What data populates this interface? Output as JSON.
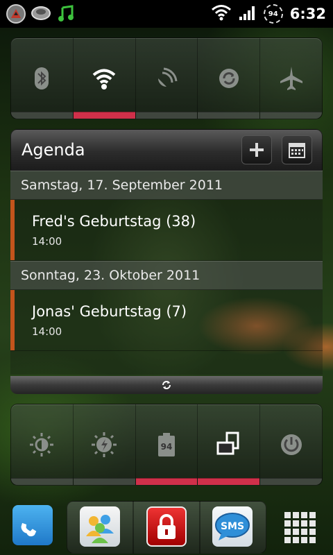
{
  "status_bar": {
    "left_icons": [
      "app-icon",
      "notification-cloud-icon",
      "music-note-icon"
    ],
    "right_icons": [
      "wifi-icon",
      "signal-icon"
    ],
    "battery_level": "94",
    "time": "6:32"
  },
  "quick_toggles_top": [
    {
      "name": "bluetooth",
      "icon": "bluetooth-icon",
      "on": false
    },
    {
      "name": "wifi",
      "icon": "wifi-icon",
      "on": true
    },
    {
      "name": "gps",
      "icon": "gps-icon",
      "on": false
    },
    {
      "name": "sync",
      "icon": "sync-icon",
      "on": false
    },
    {
      "name": "airplane",
      "icon": "airplane-icon",
      "on": false
    }
  ],
  "agenda": {
    "title": "Agenda",
    "add_icon": "plus-icon",
    "calendar_icon": "calendar-icon",
    "groups": [
      {
        "date": "Samstag, 17. September 2011",
        "events": [
          {
            "title": "Fred's Geburtstag (38)",
            "time": "14:00"
          }
        ]
      },
      {
        "date": "Sonntag, 23. Oktober 2011",
        "events": [
          {
            "title": "Jonas' Geburtstag (7)",
            "time": "14:00"
          }
        ]
      }
    ],
    "refresh_icon": "refresh-icon"
  },
  "quick_toggles_bottom": [
    {
      "name": "brightness",
      "icon": "brightness-icon",
      "on": false
    },
    {
      "name": "auto-brightness",
      "icon": "auto-brightness-icon",
      "on": false
    },
    {
      "name": "battery",
      "icon": "battery-icon",
      "label": "94",
      "on": true
    },
    {
      "name": "rotation",
      "icon": "screen-rotation-icon",
      "on": true
    },
    {
      "name": "power",
      "icon": "power-icon",
      "on": false
    }
  ],
  "dock": {
    "apps": [
      {
        "name": "phone",
        "icon": "phone-icon"
      },
      {
        "name": "contacts",
        "icon": "contacts-icon"
      },
      {
        "name": "lock",
        "icon": "lock-icon"
      },
      {
        "name": "sms",
        "icon": "sms-icon",
        "label": "SMS"
      },
      {
        "name": "app-drawer",
        "icon": "grid-icon"
      }
    ]
  },
  "colors": {
    "toggle_on": "#d0304a",
    "event_bar": "#c2541c"
  }
}
